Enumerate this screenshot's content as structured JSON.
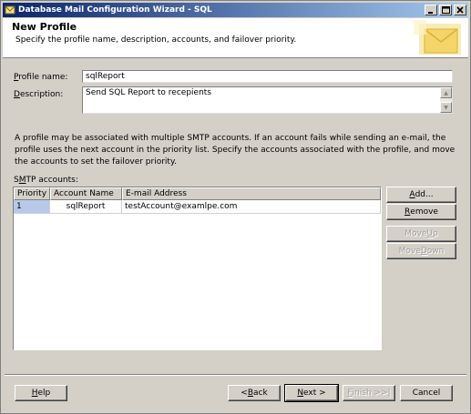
{
  "window": {
    "title": "Database Mail Configuration Wizard - SQL",
    "buttons": {
      "minimize": "_",
      "maximize": "□",
      "close": "✕"
    }
  },
  "header": {
    "title": "New Profile",
    "subtitle": "Specify the profile name, description, accounts, and failover priority."
  },
  "form": {
    "profile_name_label_pre": "",
    "profile_name_label_ul": "P",
    "profile_name_label_post": "rofile name:",
    "profile_name_value": "sqlReport",
    "description_label_ul": "D",
    "description_label_post": "escription:",
    "description_value": "Send SQL Report to recepients"
  },
  "info_text": "A profile may be associated with multiple SMTP accounts. If an account fails while sending an e-mail, the profile uses the next account in the priority list. Specify the accounts associated with the profile, and move the accounts to set the failover priority.",
  "smtp": {
    "label_pre": "S",
    "label_ul": "M",
    "label_post": "TP accounts:",
    "columns": [
      "Priority",
      "Account Name",
      "E-mail Address"
    ],
    "rows": [
      {
        "priority": "1",
        "account_name": "sqlReport",
        "email": "testAccount@examlpe.com"
      }
    ]
  },
  "side_buttons": {
    "add_ul": "A",
    "add_post": "dd...",
    "remove_ul": "R",
    "remove_post": "emove",
    "move_up_pre": "Move ",
    "move_up_ul": "U",
    "move_up_post": "p",
    "move_down_pre": "Move ",
    "move_down_ul": "D",
    "move_down_post": "own"
  },
  "footer": {
    "help_ul": "H",
    "help_post": "elp",
    "back_pre": "< ",
    "back_ul": "B",
    "back_post": "ack",
    "next_ul": "N",
    "next_post": "ext >",
    "finish_ul": "F",
    "finish_post": "inish >>|",
    "cancel": "Cancel"
  },
  "colors": {
    "titlebar_start": "#0a246a",
    "titlebar_end": "#a6caf0",
    "dialog_bg": "#d4d0c8",
    "selected_cell": "#b7c8e8"
  }
}
